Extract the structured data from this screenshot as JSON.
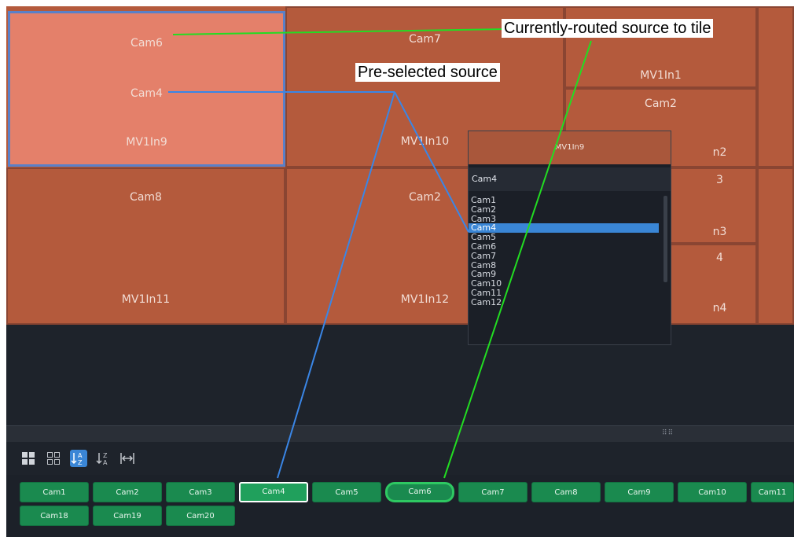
{
  "wall": {
    "tiles": {
      "t1": {
        "source": "Cam6",
        "preselected": "Cam4",
        "input": "MV1In9"
      },
      "t2": {
        "source": "Cam7",
        "input": "MV1In10"
      },
      "t3a": {
        "input": "MV1In1"
      },
      "t3b": {
        "source": "Cam2"
      },
      "t3c": {
        "partial": "n2"
      },
      "t4": {
        "source": "Cam8",
        "input": "MV1In11"
      },
      "t5": {
        "source": "Cam2",
        "input": "MV1In12"
      },
      "t6a": {
        "partial": "3"
      },
      "t6b": {
        "partial": "n3"
      },
      "t6c": {
        "partial": "4"
      },
      "t6d": {
        "partial": "n4"
      }
    }
  },
  "dropdown": {
    "header": "MV1In9",
    "selected_value": "Cam4",
    "options": [
      "Cam1",
      "Cam2",
      "Cam3",
      "Cam4",
      "Cam5",
      "Cam6",
      "Cam7",
      "Cam8",
      "Cam9",
      "Cam10",
      "Cam11",
      "Cam12"
    ],
    "highlighted": "Cam4"
  },
  "toolbar": {
    "icons": [
      "grid-layout-icon",
      "grid-outline-icon",
      "sort-ascending-icon",
      "sort-descending-icon",
      "fit-width-icon"
    ]
  },
  "sources": {
    "row1": [
      "Cam1",
      "Cam2",
      "Cam3",
      "Cam4",
      "Cam5",
      "Cam6",
      "Cam7",
      "Cam8",
      "Cam9",
      "Cam10",
      "Cam11"
    ],
    "row2": [
      "Cam18",
      "Cam19",
      "Cam20"
    ]
  },
  "callouts": {
    "current": "Currently-routed source to tile",
    "preselected": "Pre-selected source"
  },
  "colors": {
    "tile": "#b45a3c",
    "tile_selected": "#e4806a",
    "source_button": "#1a8a4f",
    "highlight": "#3a86d6",
    "callout_current_line": "#22dd22",
    "callout_preselected_line": "#3a86e6"
  }
}
